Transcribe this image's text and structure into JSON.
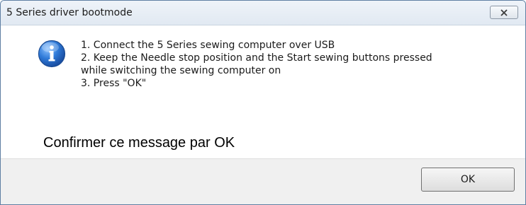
{
  "window": {
    "title": "5 Series driver bootmode",
    "close_icon": "close-icon"
  },
  "message": {
    "icon": "info-icon",
    "lines": [
      "1. Connect the 5 Series sewing computer over USB",
      "2. Keep the Needle stop position and the Start sewing buttons pressed",
      "while switching the sewing computer on",
      "3. Press \"OK\""
    ],
    "confirm_text": "Confirmer ce message par OK"
  },
  "buttons": {
    "ok_label": "OK"
  }
}
